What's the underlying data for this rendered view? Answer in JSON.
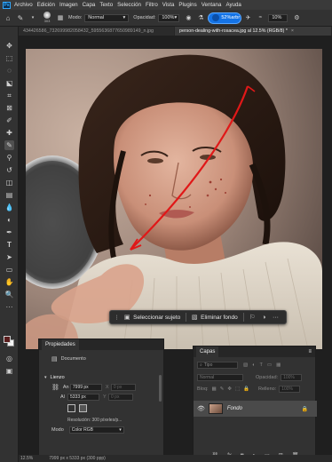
{
  "menu": {
    "app_logo": "Ps",
    "items": [
      "Archivo",
      "Edición",
      "Imagen",
      "Capa",
      "Texto",
      "Selección",
      "Filtro",
      "Vista",
      "Plugins",
      "Ventana",
      "Ayuda"
    ]
  },
  "options": {
    "brush_size": "303",
    "mode_label": "Modo:",
    "mode_value": "Normal",
    "opacity_label": "Opacidad:",
    "opacity_value": "100%",
    "flow_value": "52%",
    "flow_suffix": "arbr",
    "smoothing_value": "10%"
  },
  "tabs": [
    {
      "label": "434426586_732699982058432_5955636877650989149_n.jpg",
      "active": false
    },
    {
      "label": "person-dealing-with-rosacea.jpg al 12.5% (RGB/8) *",
      "active": true
    }
  ],
  "taskbar": {
    "select_subject": "Seleccionar sujeto",
    "remove_background": "Eliminar fondo"
  },
  "properties": {
    "title": "Propiedades",
    "doc_label": "Documento",
    "canvas_section": "Lienzo",
    "width_label": "An",
    "width_value": "7999 px",
    "height_label": "Al",
    "height_value": "5333 px",
    "x_label": "X",
    "x_value": "0 px",
    "y_label": "Y",
    "y_value": "0 px",
    "resolution": "Resolución: 300 píxeles/p...",
    "mode_label": "Modo",
    "mode_value": "Color RGB"
  },
  "layers": {
    "title": "Capas",
    "search_placeholder": "Tipo",
    "blend_mode": "Normal",
    "opacity_label": "Opacidad:",
    "opacity_value": "100%",
    "lock_label": "Bloq:",
    "fill_label": "Relleno:",
    "fill_value": "100%",
    "layer_name": "Fondo"
  },
  "status": {
    "zoom": "12.5%",
    "dimensions": "7999 px x 5333 px (300 ppp)"
  },
  "colors": {
    "accent": "#1473e6",
    "foreground_swatch": "#5a1d1d",
    "background_swatch": "#f2f2f2",
    "annotation_line": "#e01818"
  }
}
